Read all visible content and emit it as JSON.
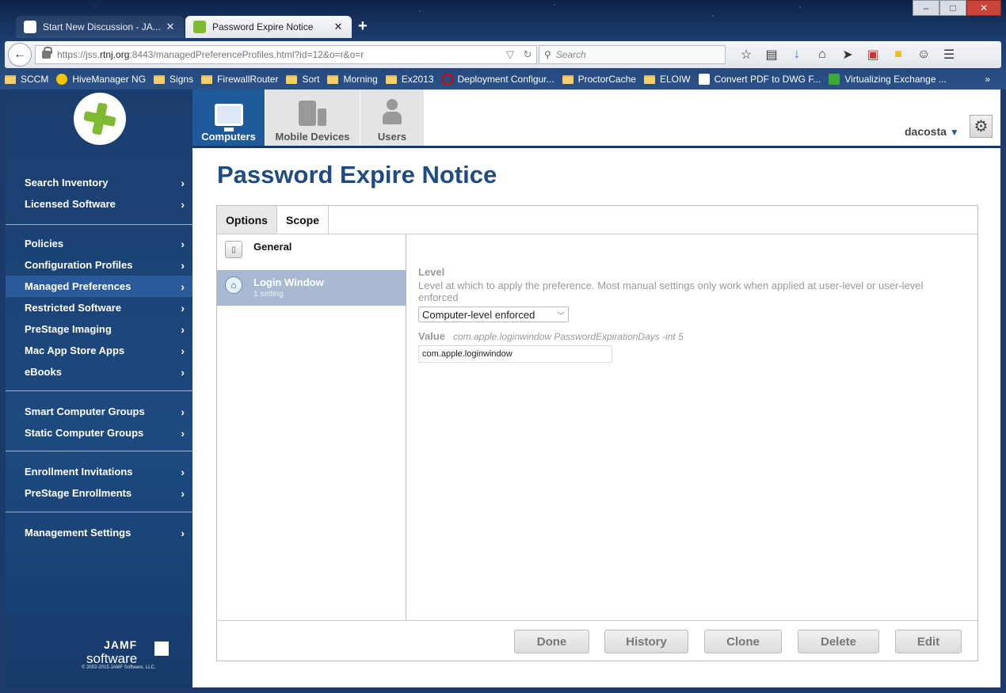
{
  "browser": {
    "tabs": [
      {
        "title": "Start New Discussion - JA...",
        "active": false
      },
      {
        "title": "Password Expire Notice",
        "active": true
      }
    ],
    "new_tab": "+",
    "url_prefix": "https://jss.",
    "url_host": "rtnj.org",
    "url_rest": ":8443/managedPreferenceProfiles.html?id=12&o=r&o=r",
    "search_placeholder": "Search",
    "bookmarks": [
      "SCCM",
      "HiveManager NG",
      "Signs",
      "FirewallRouter",
      "Sort",
      "Morning",
      "Ex2013",
      "Deployment Configur...",
      "ProctorCache",
      "ELOIW",
      "Convert PDF to DWG F...",
      "Virtualizing Exchange ..."
    ],
    "bookmarks_more": "»"
  },
  "app": {
    "top_tabs": {
      "computers": "Computers",
      "mobile": "Mobile Devices",
      "users": "Users"
    },
    "user": "dacosta",
    "page_title": "Password Expire Notice",
    "sidebar": {
      "group1": [
        "Search Inventory",
        "Licensed Software"
      ],
      "group2": [
        "Policies",
        "Configuration Profiles",
        "Managed Preferences",
        "Restricted Software",
        "PreStage Imaging",
        "Mac App Store Apps",
        "eBooks"
      ],
      "group3": [
        "Smart Computer Groups",
        "Static Computer Groups"
      ],
      "group4": [
        "Enrollment Invitations",
        "PreStage Enrollments"
      ],
      "group5": [
        "Management Settings"
      ],
      "active": "Managed Preferences",
      "footer_brand": "JAMF",
      "footer_software": "software",
      "copyright": "© 2002-2015 JAMF Software, LLC."
    },
    "panel_tabs": {
      "options": "Options",
      "scope": "Scope"
    },
    "payloads": {
      "general": "General",
      "login_window": "Login Window",
      "login_window_count": "1 setting"
    },
    "detail": {
      "level_label": "Level",
      "level_desc": "Level at which to apply the preference. Most manual settings only work when applied at user-level or user-level enforced",
      "level_value": "Computer-level enforced",
      "value_label": "Value",
      "value_hint": "com.apple.loginwindow PasswordExpirationDays -int 5",
      "value_input": "com.apple.loginwindow"
    },
    "buttons": {
      "done": "Done",
      "history": "History",
      "clone": "Clone",
      "delete": "Delete",
      "edit": "Edit"
    }
  },
  "colors": {
    "accent": "#1f4a82",
    "sidebar": "#1e4a80",
    "active_payload": "#a8b9d1"
  }
}
